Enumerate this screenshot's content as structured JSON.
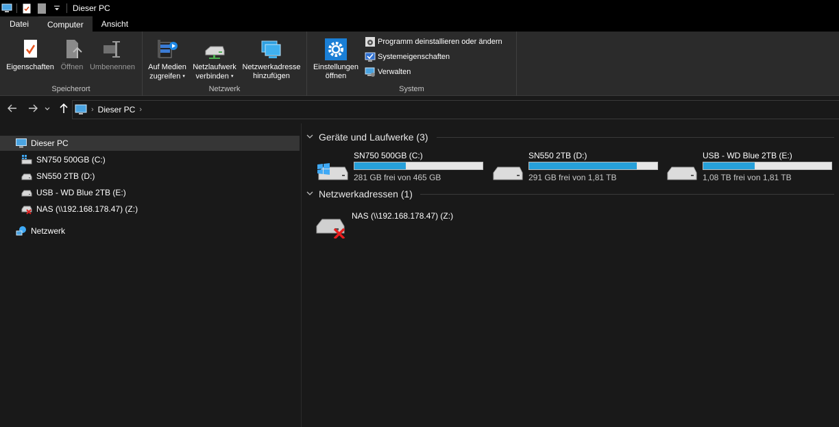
{
  "window": {
    "title": "Dieser PC"
  },
  "ribbon": {
    "tabs": [
      {
        "label": "Datei"
      },
      {
        "label": "Computer"
      },
      {
        "label": "Ansicht"
      }
    ],
    "groups": {
      "speicherort": {
        "label": "Speicherort",
        "buttons": [
          {
            "label": "Eigenschaften",
            "icon": "properties-icon"
          },
          {
            "label": "Öffnen",
            "icon": "open-icon"
          },
          {
            "label": "Umbenennen",
            "icon": "rename-icon"
          }
        ]
      },
      "netzwerk": {
        "label": "Netzwerk",
        "buttons": [
          {
            "label1": "Auf Medien",
            "label2": "zugreifen",
            "icon": "media-access-icon"
          },
          {
            "label1": "Netzlaufwerk",
            "label2": "verbinden",
            "icon": "map-network-drive-icon"
          },
          {
            "label1": "Netzwerkadresse",
            "label2": "hinzufügen",
            "icon": "add-network-location-icon"
          }
        ]
      },
      "system": {
        "label": "System",
        "big_button": {
          "label1": "Einstellungen",
          "label2": "öffnen",
          "icon": "settings-gear-icon"
        },
        "small_buttons": [
          {
            "label": "Programm deinstallieren oder ändern",
            "icon": "uninstall-icon"
          },
          {
            "label": "Systemeigenschaften",
            "icon": "system-properties-icon"
          },
          {
            "label": "Verwalten",
            "icon": "manage-icon"
          }
        ]
      }
    }
  },
  "address": {
    "crumbs": [
      "Dieser PC"
    ]
  },
  "navpane": {
    "items": [
      {
        "label": "Dieser PC",
        "icon": "pc-icon"
      },
      {
        "label": "SN750 500GB (C:)",
        "icon": "system-drive-icon"
      },
      {
        "label": "SN550 2TB (D:)",
        "icon": "drive-icon"
      },
      {
        "label": "USB - WD Blue 2TB (E:)",
        "icon": "drive-icon"
      },
      {
        "label": "NAS (\\\\192.168.178.47) (Z:)",
        "icon": "network-drive-disconnected-icon"
      },
      {
        "label": "Netzwerk",
        "icon": "network-icon"
      }
    ]
  },
  "content": {
    "sections": [
      {
        "title": "Geräte und Laufwerke (3)"
      },
      {
        "title": "Netzwerkadressen (1)"
      }
    ],
    "drives": [
      {
        "name": "SN750 500GB (C:)",
        "free": "281 GB frei von 465 GB",
        "used_fraction": 0.4
      },
      {
        "name": "SN550 2TB (D:)",
        "free": "291 GB frei von 1,81 TB",
        "used_fraction": 0.84
      },
      {
        "name": "USB - WD Blue 2TB (E:)",
        "free": "1,08 TB frei von 1,81 TB",
        "used_fraction": 0.4
      }
    ],
    "network_locations": [
      {
        "name": "NAS (\\\\192.168.178.47) (Z:)"
      }
    ]
  },
  "colors": {
    "accent": "#26a0da",
    "background": "#191919",
    "ribbon": "#2b2b2b"
  }
}
